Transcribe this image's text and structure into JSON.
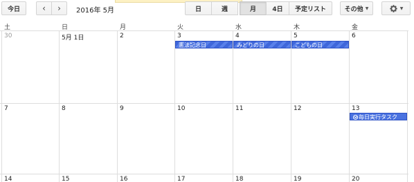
{
  "toolbar": {
    "today": "今日",
    "prev": "‹",
    "next": "›",
    "date_range": "2016年 5月",
    "view_day": "日",
    "view_week": "週",
    "view_month": "月",
    "view_4days": "4日",
    "view_agenda": "予定リスト",
    "more": "その他",
    "active_view": "月"
  },
  "weekdays": [
    "土",
    "日",
    "月",
    "火",
    "水",
    "木",
    "金"
  ],
  "weeks": [
    {
      "days": [
        "30",
        "5月 1日",
        "2",
        "3",
        "4",
        "5",
        "6"
      ],
      "other_month": [
        true,
        false,
        false,
        false,
        false,
        false,
        false
      ]
    },
    {
      "days": [
        "7",
        "8",
        "9",
        "10",
        "11",
        "12",
        "13"
      ],
      "other_month": [
        false,
        false,
        false,
        false,
        false,
        false,
        false
      ]
    },
    {
      "days": [
        "14",
        "15",
        "16",
        "17",
        "18",
        "19",
        "20"
      ],
      "other_month": [
        false,
        false,
        false,
        false,
        false,
        false,
        false
      ]
    }
  ],
  "events": {
    "kenpo": "憲法記念日",
    "midori": "みどりの日",
    "kodomo": "こどもの日",
    "task": "毎日実行タスク"
  },
  "colors": {
    "event_blue": "#3f67da",
    "grid": "#dddddd"
  }
}
